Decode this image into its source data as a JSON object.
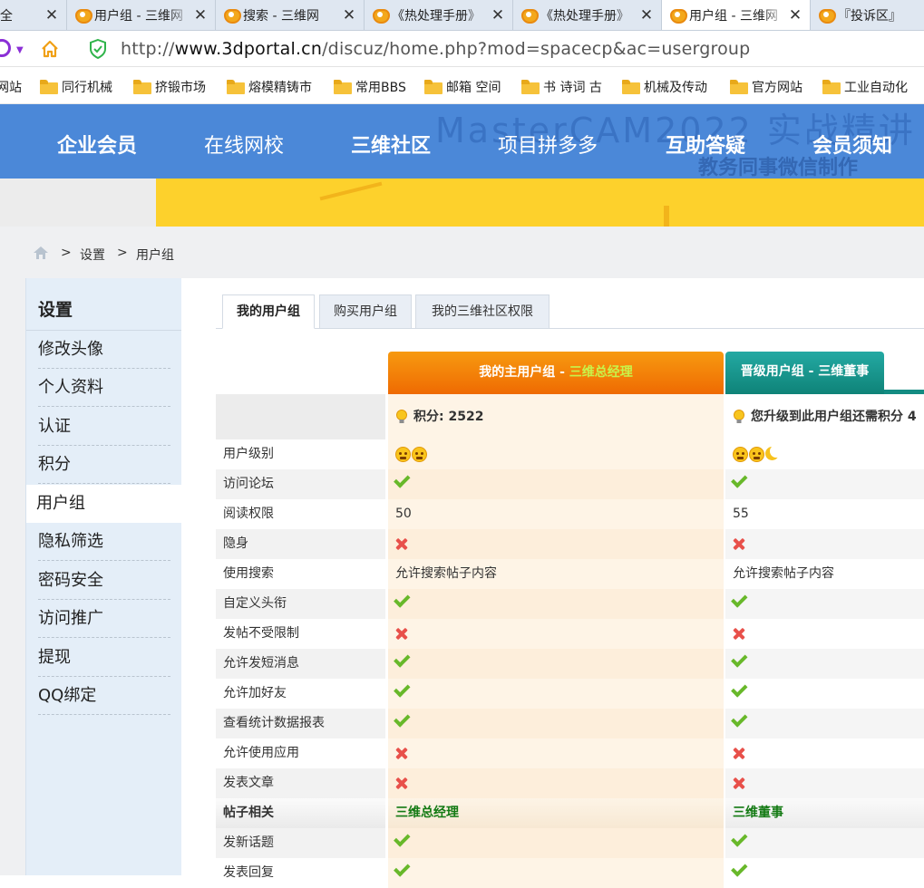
{
  "browser": {
    "tabs": [
      {
        "title": "全",
        "active": false
      },
      {
        "title": "用户组 - 三维网",
        "active": false
      },
      {
        "title": "搜索 - 三维网",
        "active": false
      },
      {
        "title": "《热处理手册》",
        "active": false
      },
      {
        "title": "《热处理手册》",
        "active": false
      },
      {
        "title": "用户组 - 三维网",
        "active": true
      },
      {
        "title": "『投诉区』",
        "active": false
      }
    ],
    "close_glyph": "✕",
    "url_prefix": "http://",
    "url_host": "www.3dportal.cn",
    "url_path": "/discuz/home.php?mod=spacecp&ac=usergroup",
    "bookmarks": [
      "网站",
      "同行机械",
      "挤锻市场",
      "熔模精铸市",
      "常用BBS",
      "邮箱 空间",
      "书 诗词 古",
      "机械及传动",
      "官方网站",
      "工业自动化"
    ]
  },
  "site_nav": {
    "items": [
      "企业会员",
      "在线网校",
      "三维社区",
      "项目拼多多",
      "互助答疑",
      "会员须知"
    ],
    "watermark": "MasterCAM2022 实战精讲",
    "watermark2": "教务同事微信制作"
  },
  "breadcrumb": {
    "items": [
      "设置",
      "用户组"
    ],
    "separator": ">"
  },
  "sidebar": {
    "title": "设置",
    "items": [
      "修改头像",
      "个人资料",
      "认证",
      "积分",
      "用户组",
      "隐私筛选",
      "密码安全",
      "访问推广",
      "提现",
      "QQ绑定"
    ],
    "active": "用户组"
  },
  "subtabs": [
    "我的用户组",
    "购买用户组",
    "我的三维社区权限"
  ],
  "groups": {
    "main_label": "我的主用户组",
    "main_name": "三维总经理",
    "next_label": "晋级用户组",
    "next_name": "三维董事",
    "dash": " - ",
    "points_label": "积分: 2522",
    "upgrade_label": "您升级到此用户组还需积分 4"
  },
  "rows": [
    {
      "label": "用户级别",
      "v1": "icon:face2",
      "v2": "icon:face2moon"
    },
    {
      "label": "访问论坛",
      "v1": "yes",
      "v2": "yes"
    },
    {
      "label": "阅读权限",
      "v1": "50",
      "v2": "55"
    },
    {
      "label": "隐身",
      "v1": "no",
      "v2": "no"
    },
    {
      "label": "使用搜索",
      "v1": "允许搜索帖子内容",
      "v2": "允许搜索帖子内容"
    },
    {
      "label": "自定义头衔",
      "v1": "yes",
      "v2": "yes"
    },
    {
      "label": "发帖不受限制",
      "v1": "no",
      "v2": "no"
    },
    {
      "label": "允许发短消息",
      "v1": "yes",
      "v2": "yes"
    },
    {
      "label": "允许加好友",
      "v1": "yes",
      "v2": "yes"
    },
    {
      "label": "查看统计数据报表",
      "v1": "yes",
      "v2": "yes"
    },
    {
      "label": "允许使用应用",
      "v1": "no",
      "v2": "no"
    },
    {
      "label": "发表文章",
      "v1": "no",
      "v2": "no"
    },
    {
      "label": "帖子相关",
      "v1": "三维总经理",
      "v2": "三维董事",
      "section": true
    },
    {
      "label": "发新话题",
      "v1": "yes",
      "v2": "yes"
    },
    {
      "label": "发表回复",
      "v1": "yes",
      "v2": "yes"
    }
  ],
  "colors": {
    "nav_blue": "#4b88d8",
    "banner_yellow": "#fdd12c",
    "main_group_orange": "#ef6a02",
    "next_group_teal": "#0f8378",
    "check_green": "#68b82a",
    "cross_red": "#e8504a"
  }
}
